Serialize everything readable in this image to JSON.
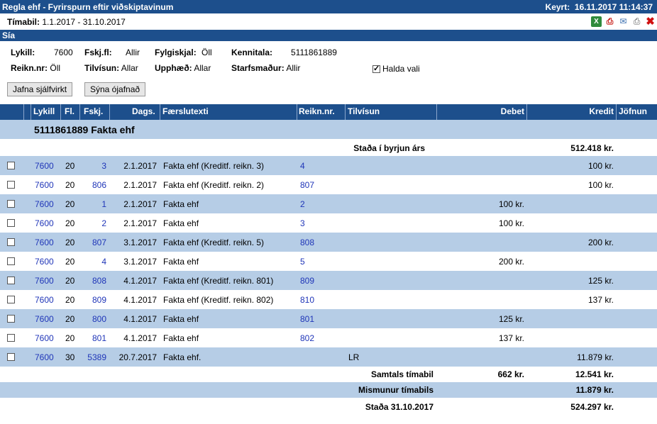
{
  "title": "Regla ehf - Fyrirspurn eftir viðskiptavinum",
  "run_label": "Keyrt:",
  "run_time": "16.11.2017 11:14:37",
  "period_label": "Tímabil:",
  "period_value": "1.1.2017 - 31.10.2017",
  "toolbar_icons": [
    "excel-icon",
    "pdf-icon",
    "mail-icon",
    "print-icon",
    "close-icon"
  ],
  "filter_section": "Sía",
  "filters": {
    "lykill_label": "Lykill:",
    "lykill_value": "7600",
    "fskjfl_label": "Fskj.fl:",
    "fskjfl_value": "Allir",
    "fylgiskjal_label": "Fylgiskjal:",
    "fylgiskjal_value": "Öll",
    "kennitala_label": "Kennitala:",
    "kennitala_value": "5111861889",
    "reiknnr_label": "Reikn.nr:",
    "reiknnr_value": "Öll",
    "tilvisun_label": "Tilvísun:",
    "tilvisun_value": "Allar",
    "upphaed_label": "Upphæð:",
    "upphaed_value": "Allar",
    "starfsmadur_label": "Starfsmaður:",
    "starfsmadur_value": "Allir",
    "halda_vali_label": "Halda vali",
    "halda_vali_checked": true
  },
  "buttons": {
    "auto_match": "Jafna sjálfvirkt",
    "show_unmatched": "Sýna ójafnað"
  },
  "columns": {
    "lykill": "Lykill",
    "fl": "Fl.",
    "fskj": "Fskj.",
    "dags": "Dags.",
    "faerslutexti": "Færslutexti",
    "reiknnr": "Reikn.nr.",
    "tilvisun": "Tilvísun",
    "debet": "Debet",
    "kredit": "Kredit",
    "jofnun": "Jöfnun"
  },
  "group_title": "5111861889 Fakta ehf",
  "opening": {
    "label": "Staða í byrjun árs",
    "kredit": "512.418 kr."
  },
  "rows": [
    {
      "lykill": "7600",
      "fl": "20",
      "fskj": "3",
      "dags": "2.1.2017",
      "text": "Fakta ehf (Kreditf. reikn. 3)",
      "reikn": "4",
      "tilv": "",
      "debet": "",
      "kredit": "100 kr."
    },
    {
      "lykill": "7600",
      "fl": "20",
      "fskj": "806",
      "dags": "2.1.2017",
      "text": "Fakta ehf (Kreditf. reikn. 2)",
      "reikn": "807",
      "tilv": "",
      "debet": "",
      "kredit": "100 kr."
    },
    {
      "lykill": "7600",
      "fl": "20",
      "fskj": "1",
      "dags": "2.1.2017",
      "text": "Fakta ehf",
      "reikn": "2",
      "tilv": "",
      "debet": "100 kr.",
      "kredit": ""
    },
    {
      "lykill": "7600",
      "fl": "20",
      "fskj": "2",
      "dags": "2.1.2017",
      "text": "Fakta ehf",
      "reikn": "3",
      "tilv": "",
      "debet": "100 kr.",
      "kredit": ""
    },
    {
      "lykill": "7600",
      "fl": "20",
      "fskj": "807",
      "dags": "3.1.2017",
      "text": "Fakta ehf (Kreditf. reikn. 5)",
      "reikn": "808",
      "tilv": "",
      "debet": "",
      "kredit": "200 kr."
    },
    {
      "lykill": "7600",
      "fl": "20",
      "fskj": "4",
      "dags": "3.1.2017",
      "text": "Fakta ehf",
      "reikn": "5",
      "tilv": "",
      "debet": "200 kr.",
      "kredit": ""
    },
    {
      "lykill": "7600",
      "fl": "20",
      "fskj": "808",
      "dags": "4.1.2017",
      "text": "Fakta ehf (Kreditf. reikn. 801)",
      "reikn": "809",
      "tilv": "",
      "debet": "",
      "kredit": "125 kr."
    },
    {
      "lykill": "7600",
      "fl": "20",
      "fskj": "809",
      "dags": "4.1.2017",
      "text": "Fakta ehf (Kreditf. reikn. 802)",
      "reikn": "810",
      "tilv": "",
      "debet": "",
      "kredit": "137 kr."
    },
    {
      "lykill": "7600",
      "fl": "20",
      "fskj": "800",
      "dags": "4.1.2017",
      "text": "Fakta ehf",
      "reikn": "801",
      "tilv": "",
      "debet": "125 kr.",
      "kredit": ""
    },
    {
      "lykill": "7600",
      "fl": "20",
      "fskj": "801",
      "dags": "4.1.2017",
      "text": "Fakta ehf",
      "reikn": "802",
      "tilv": "",
      "debet": "137 kr.",
      "kredit": ""
    },
    {
      "lykill": "7600",
      "fl": "30",
      "fskj": "5389",
      "dags": "20.7.2017",
      "text": "Fakta ehf.",
      "reikn": "",
      "tilv": "LR",
      "debet": "",
      "kredit": "11.879 kr."
    }
  ],
  "totals": {
    "period_label": "Samtals tímabil",
    "period_debet": "662 kr.",
    "period_kredit": "12.541 kr.",
    "diff_label": "Mismunur tímabils",
    "diff_kredit": "11.879 kr.",
    "closing_label": "Staða 31.10.2017",
    "closing_kredit": "524.297 kr."
  }
}
